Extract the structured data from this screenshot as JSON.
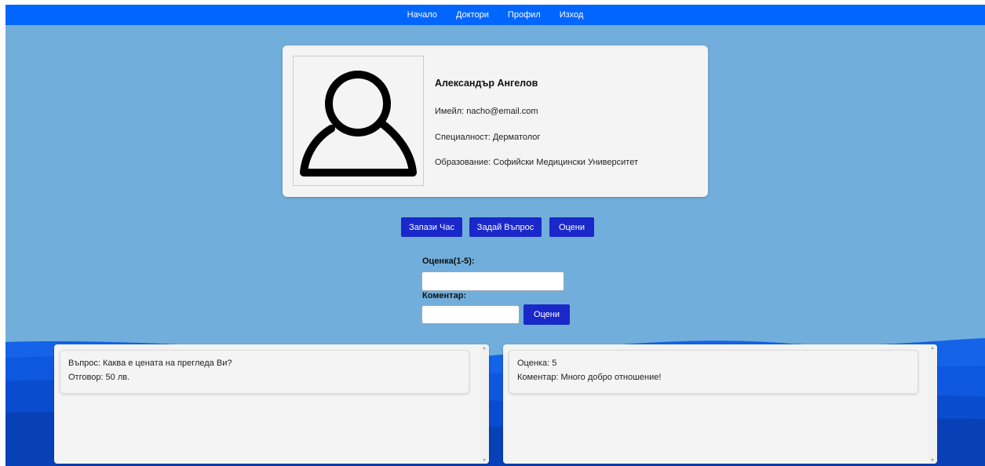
{
  "nav": {
    "items": [
      "Начало",
      "Доктори",
      "Профил",
      "Изход"
    ]
  },
  "profile": {
    "avatar_icon": "user-icon",
    "name": "Александър Ангелов",
    "email_line": "Имейл: nacho@email.com",
    "specialty_line": "Специалност: Дерматолог",
    "education_line": "Образование: Софийски Медицински Университет"
  },
  "actions": {
    "appointment_label": "Запази Час",
    "question_label": "Задай Въпрос",
    "rate_label": "Оцени"
  },
  "rating_form": {
    "rating_label": "Оценка(1-5):",
    "rating_value": "",
    "comment_label": "Коментар:",
    "comment_value": "",
    "submit_label": "Оцени"
  },
  "questions": {
    "items": [
      {
        "question": "Въпрос: Каква е цената на прегледа Ви?",
        "answer": "Отговор: 50 лв."
      }
    ]
  },
  "reviews": {
    "items": [
      {
        "rating": "Оценка: 5",
        "comment": "Коментар: Много добро отношение!"
      }
    ]
  },
  "colors": {
    "navbar": "#0066ff",
    "background": "#72aedb",
    "button": "#1a28c9",
    "card": "#f4f4f4"
  }
}
